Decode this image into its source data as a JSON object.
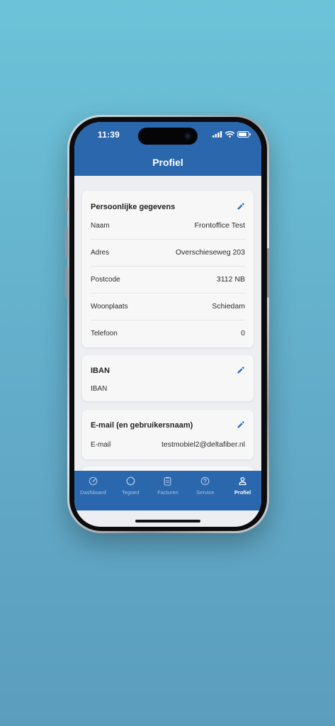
{
  "status_bar": {
    "time": "11:39",
    "icons": [
      "signal-bars-icon",
      "wifi-icon",
      "battery-icon"
    ]
  },
  "header": {
    "title": "Profiel"
  },
  "sections": {
    "personal": {
      "title": "Persoonlijke gegevens",
      "icon": "pencil-icon",
      "rows": [
        {
          "label": "Naam",
          "value": "Frontoffice Test"
        },
        {
          "label": "Adres",
          "value": "Overschieseweg 203"
        },
        {
          "label": "Postcode",
          "value": "3112 NB"
        },
        {
          "label": "Woonplaats",
          "value": "Schiedam"
        },
        {
          "label": "Telefoon",
          "value": "0"
        }
      ]
    },
    "iban": {
      "title": "IBAN",
      "icon": "pencil-icon",
      "rows": [
        {
          "label": "IBAN",
          "value": ""
        }
      ]
    },
    "email": {
      "title": "E-mail (en gebruikersnaam)",
      "icon": "pencil-icon",
      "rows": [
        {
          "label": "E-mail",
          "value": "testmobiel2@deltafiber.nl"
        }
      ]
    }
  },
  "bottom_nav": {
    "items": [
      {
        "label": "Dashboard",
        "icon": "speedometer-icon"
      },
      {
        "label": "Tegoed",
        "icon": "circle-progress-icon"
      },
      {
        "label": "Facturen",
        "icon": "clipboard-icon"
      },
      {
        "label": "Service",
        "icon": "help-circle-icon"
      },
      {
        "label": "Profiel",
        "icon": "person-icon"
      }
    ],
    "active": "Profiel"
  },
  "colors": {
    "background": "#63acc9",
    "primary": "#2a67ad",
    "card": "#f7f7f7",
    "accent_icon": "#2a79c6",
    "nav_inactive": "#a9c3e2",
    "nav_active": "#ffffff"
  }
}
